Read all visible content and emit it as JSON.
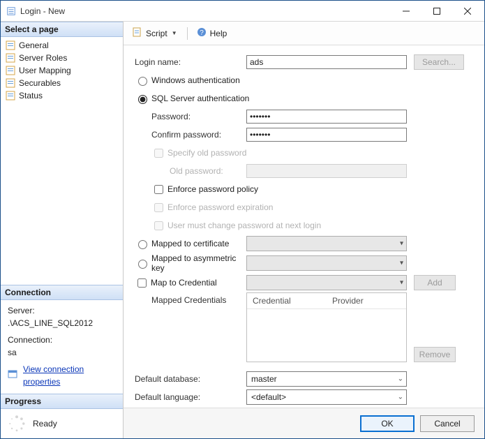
{
  "window": {
    "title": "Login - New"
  },
  "sidebar": {
    "heading": "Select a page",
    "items": [
      {
        "label": "General"
      },
      {
        "label": "Server Roles"
      },
      {
        "label": "User Mapping"
      },
      {
        "label": "Securables"
      },
      {
        "label": "Status"
      }
    ]
  },
  "connection": {
    "heading": "Connection",
    "server_label": "Server:",
    "server_value": ".\\ACS_LINE_SQL2012",
    "conn_label": "Connection:",
    "conn_value": "sa",
    "link": "View connection properties"
  },
  "progress": {
    "heading": "Progress",
    "status": "Ready"
  },
  "toolbar": {
    "script": "Script",
    "help": "Help"
  },
  "form": {
    "login_name_label": "Login name:",
    "login_name_value": "ads",
    "search_btn": "Search...",
    "radio_windows": "Windows authentication",
    "radio_sql": "SQL Server authentication",
    "password_label": "Password:",
    "password_value": "•••••••",
    "confirm_label": "Confirm password:",
    "confirm_value": "•••••••",
    "spec_old": "Specify old password",
    "old_pw_label": "Old password:",
    "enforce_policy": "Enforce password policy",
    "enforce_exp": "Enforce password expiration",
    "must_change": "User must change password at next login",
    "radio_cert": "Mapped to certificate",
    "radio_asym": "Mapped to asymmetric key",
    "map_cred_chk": "Map to Credential",
    "add_btn": "Add",
    "mapped_creds_label": "Mapped Credentials",
    "grid_col1": "Credential",
    "grid_col2": "Provider",
    "remove_btn": "Remove",
    "default_db_label": "Default database:",
    "default_db_value": "master",
    "default_lang_label": "Default language:",
    "default_lang_value": "<default>"
  },
  "footer": {
    "ok": "OK",
    "cancel": "Cancel"
  }
}
